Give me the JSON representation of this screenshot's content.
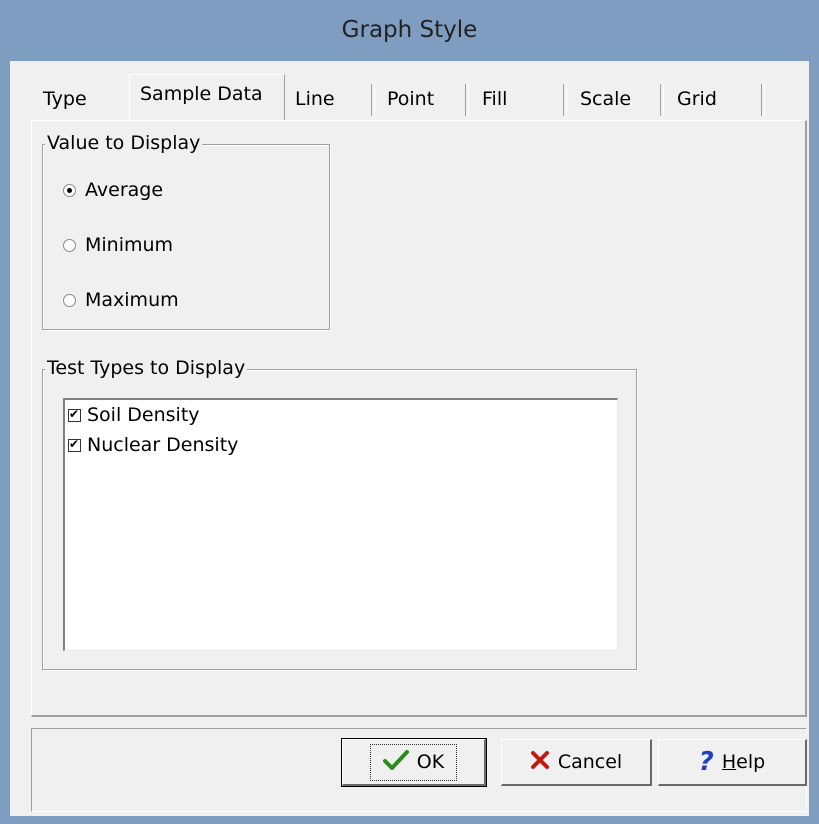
{
  "window": {
    "title": "Graph Style"
  },
  "tabs": [
    {
      "label": "Type"
    },
    {
      "label": "Sample Data"
    },
    {
      "label": "Line"
    },
    {
      "label": "Point"
    },
    {
      "label": "Fill"
    },
    {
      "label": "Scale"
    },
    {
      "label": "Grid"
    }
  ],
  "active_tab": "Sample Data",
  "value_to_display": {
    "label": "Value to Display",
    "options": [
      {
        "label": "Average",
        "checked": true
      },
      {
        "label": "Minimum",
        "checked": false
      },
      {
        "label": "Maximum",
        "checked": false
      }
    ]
  },
  "test_types": {
    "label": "Test Types to Display",
    "items": [
      {
        "label": "Soil Density",
        "checked": true
      },
      {
        "label": "Nuclear Density",
        "checked": true
      }
    ]
  },
  "buttons": {
    "ok": {
      "label": "OK",
      "icon": "checkmark-icon",
      "color": "#2c8a1e"
    },
    "cancel": {
      "label": "Cancel",
      "icon": "x-icon",
      "color": "#c01a10"
    },
    "help": {
      "label_mnemonic": "H",
      "label_rest": "elp",
      "icon": "question-mark-icon",
      "color": "#1f3fc0"
    }
  }
}
